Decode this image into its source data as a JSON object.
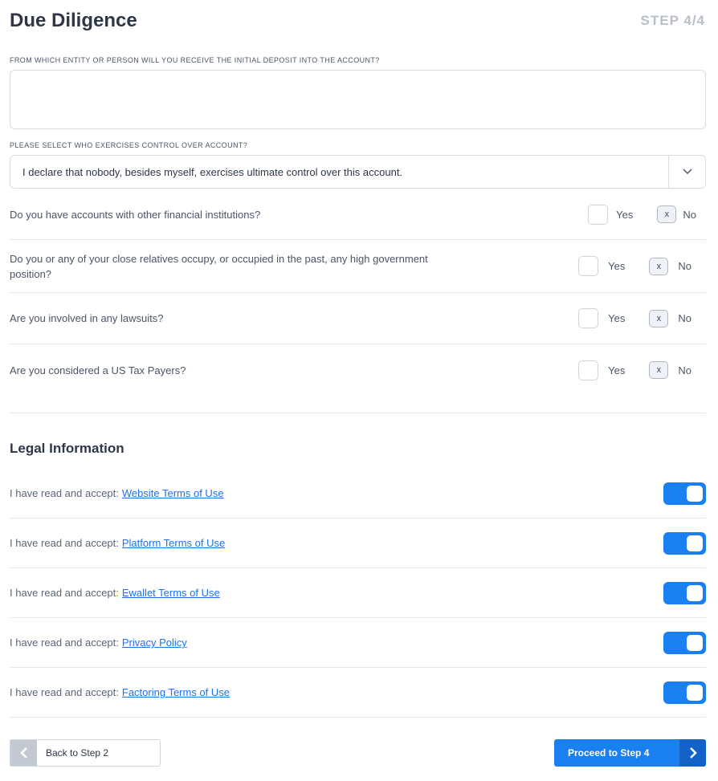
{
  "header": {
    "title": "Due Diligence",
    "step": "STEP 4/4"
  },
  "deposit": {
    "label": "FROM WHICH ENTITY OR PERSON WILL YOU RECEIVE THE INITIAL DEPOSIT INTO THE ACCOUNT?",
    "value": ""
  },
  "control": {
    "label": "PLEASE SELECT WHO EXERCISES CONTROL OVER ACCOUNT?",
    "selected": "I declare that nobody, besides myself, exercises ultimate control over this account."
  },
  "questions": [
    {
      "text": "Do you have accounts with other financial institutions?",
      "yes": "Yes",
      "no": "No",
      "answer": "No"
    },
    {
      "text": "Do you or any of your close relatives occupy, or occupied in the past, any high government position?",
      "yes": "Yes",
      "no": "No",
      "answer": "No"
    },
    {
      "text": "Are you involved in any lawsuits?",
      "yes": "Yes",
      "no": "No",
      "answer": "No"
    },
    {
      "text": "Are you considered a US Tax Payers?",
      "yes": "Yes",
      "no": "No",
      "answer": "No"
    }
  ],
  "checkmark": "x",
  "legal": {
    "title": "Legal Information",
    "prefix": "I have read and accept:",
    "items": [
      {
        "link": "Website Terms of Use",
        "accepted": true
      },
      {
        "link": "Platform Terms of Use",
        "accepted": true
      },
      {
        "link": "Ewallet Terms of Use",
        "accepted": true
      },
      {
        "link": "Privacy Policy",
        "accepted": true
      },
      {
        "link": "Factoring Terms of Use",
        "accepted": true
      }
    ]
  },
  "nav": {
    "back": "Back to Step 2",
    "next": "Proceed to Step 4"
  },
  "colors": {
    "accent": "#1a7ff0",
    "text": "#2d3748",
    "muted": "#b8bfc9"
  }
}
